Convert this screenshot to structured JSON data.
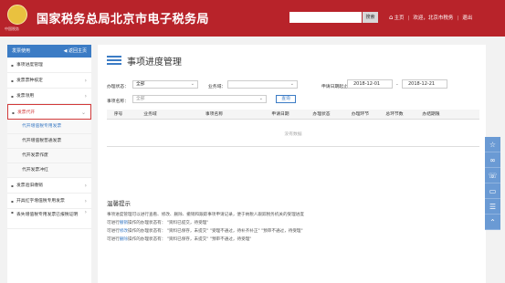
{
  "header": {
    "title": "国家税务总局北京市电子税务局",
    "logo_caption": "中国税务",
    "search_placeholder": "",
    "search_button": "搜索",
    "home": "主页",
    "welcome": "欢迎，北京市税务",
    "logout": "退出",
    "colors": {
      "brand": "#b8232a",
      "accent": "#3c7cc5"
    }
  },
  "sidebar": {
    "head_label": "发票使用",
    "back_label": "◀ 返回主页",
    "items": [
      {
        "label": "事项进度管理",
        "type": "dot"
      },
      {
        "label": "发票票种核定",
        "type": "collapsed"
      },
      {
        "label": "发票领用",
        "type": "collapsed"
      },
      {
        "label": "发票代开",
        "type": "expanded"
      },
      {
        "label": "代开增值税专用发票",
        "type": "sub"
      },
      {
        "label": "代开增值税普通发票",
        "type": "sub"
      },
      {
        "label": "代开发票作废",
        "type": "sub"
      },
      {
        "label": "代开发票冲红",
        "type": "sub"
      },
      {
        "label": "发票验旧缴销",
        "type": "collapsed"
      },
      {
        "label": "开具红字增值税专用发票",
        "type": "collapsed"
      },
      {
        "label": "丢失增值税专用发票已报税证明",
        "type": "collapsed"
      }
    ]
  },
  "main": {
    "title": "事项进度管理",
    "filters": {
      "status_label": "办理状态：",
      "status_value": "全部",
      "domain_label": "业务域：",
      "domain_value": "",
      "date_label": "申请日期起止：",
      "date_from": "2018-12-01",
      "date_sep": "-",
      "date_to": "2018-12-21",
      "name_label": "事项名称：",
      "name_value": "全部",
      "query_button": "查询"
    },
    "table": {
      "columns": [
        "序号",
        "业务域",
        "事项名称",
        "申请日期",
        "办理状态",
        "办理环节",
        "总环节数",
        "办结期限"
      ],
      "empty_text": "没有数据"
    },
    "tips": {
      "title": "温馨提示",
      "lines": [
        {
          "pre": "事项进度管理可以进行查看、修改、删除、撤销和跟踪事项申请记录，便于纳税人跟踪税务机关的受理进度",
          "hl": "",
          "post": ""
        },
        {
          "pre": "可进行",
          "hl": "撤销",
          "post": "操作的办理状态有：  \"资料已提交，待受理\""
        },
        {
          "pre": "可进行",
          "hl": "修改",
          "post": "操作的办理状态有：  \"资料已保存，未提交\"  \"受理不通过，待补齐补正\"  \"预审不通过，待受理\""
        },
        {
          "pre": "可进行",
          "hl": "删除",
          "post": "操作的办理状态有：  \"资料已保存，未提交\"  \"预审不通过，待受理\""
        }
      ]
    }
  },
  "float_bar": [
    "star-icon",
    "link-icon",
    "phone-icon",
    "chat-icon",
    "list-icon",
    "arrow-up-icon"
  ]
}
